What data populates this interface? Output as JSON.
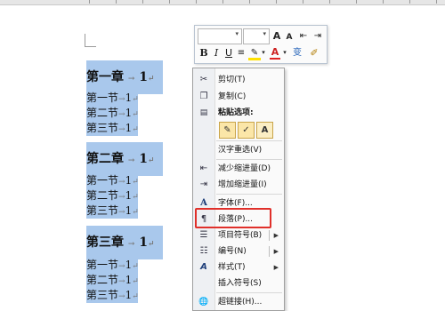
{
  "document": {
    "chapters": [
      {
        "title": "第一章",
        "number": "1",
        "sections": [
          "第一节",
          "第二节",
          "第三节"
        ]
      },
      {
        "title": "第二章",
        "number": "1",
        "sections": [
          "第一节",
          "第二节",
          "第三节"
        ]
      },
      {
        "title": "第三章",
        "number": "1",
        "sections": [
          "第一节",
          "第二节",
          "第三节"
        ]
      }
    ],
    "tab_mark": "→",
    "para_mark": "↵",
    "sec_suffix": "1"
  },
  "mini_toolbar": {
    "font_name": "",
    "font_size": "",
    "grow_font": "A",
    "shrink_font": "A",
    "bold": "B",
    "italic": "I",
    "underline": "U",
    "font_color": "A",
    "phonetic": "变"
  },
  "context_menu": {
    "items": [
      {
        "icon": "scissors-icon",
        "glyph": "✂",
        "label": "剪切(T)"
      },
      {
        "icon": "copy-icon",
        "glyph": "❐",
        "label": "复制(C)"
      },
      {
        "icon": "paste-icon",
        "glyph": "📋",
        "label": "粘贴选项:"
      },
      {
        "icon": "",
        "glyph": "",
        "label": "汉字重选(V)"
      },
      {
        "icon": "decrease-indent-icon",
        "glyph": "⇤",
        "label": "减少缩进量(D)"
      },
      {
        "icon": "increase-indent-icon",
        "glyph": "⇥",
        "label": "增加缩进量(I)"
      },
      {
        "icon": "font-icon",
        "glyph": "A",
        "label": "字体(F)..."
      },
      {
        "icon": "paragraph-icon",
        "glyph": "¶",
        "label": "段落(P)..."
      },
      {
        "icon": "bullets-icon",
        "glyph": "☰",
        "label": "项目符号(B)"
      },
      {
        "icon": "numbering-icon",
        "glyph": "☷",
        "label": "编号(N)"
      },
      {
        "icon": "styles-icon",
        "glyph": "A",
        "label": "样式(T)"
      },
      {
        "icon": "",
        "glyph": "",
        "label": "插入符号(S)"
      },
      {
        "icon": "hyperlink-icon",
        "glyph": "🌐",
        "label": "超链接(H)..."
      }
    ],
    "paste_buttons": [
      "✎",
      "✓",
      "A"
    ],
    "submenu_arrow": "▶"
  }
}
